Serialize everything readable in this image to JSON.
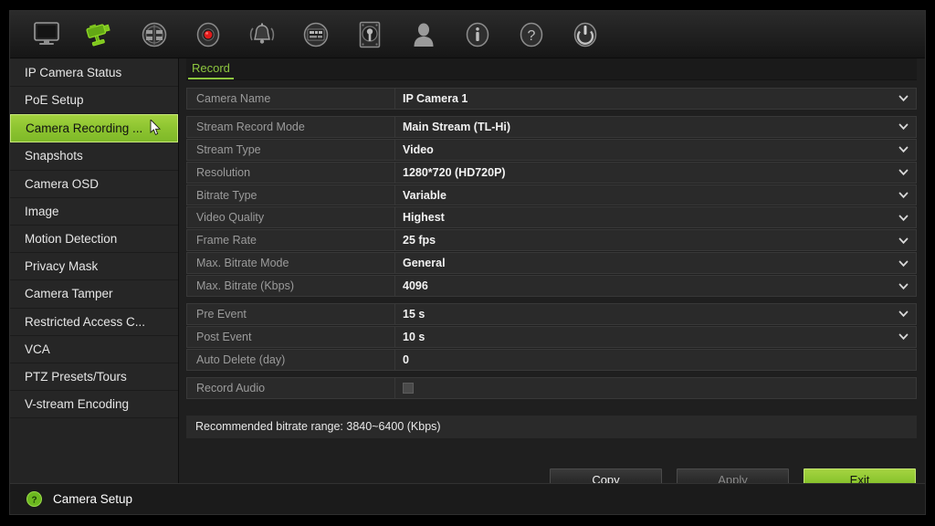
{
  "toolbar": {
    "items": [
      {
        "icon": "monitor-icon",
        "label": "Display",
        "active": false
      },
      {
        "icon": "camera-icon",
        "label": "Camera Setup",
        "active": true
      },
      {
        "icon": "network-icon",
        "label": "Network",
        "active": false
      },
      {
        "icon": "record-icon",
        "label": "Recording",
        "active": false
      },
      {
        "icon": "alarm-bell-icon",
        "label": "Alarm",
        "active": false
      },
      {
        "icon": "device-icon",
        "label": "Device",
        "active": false
      },
      {
        "icon": "hard-disk-icon",
        "label": "Storage",
        "active": false
      },
      {
        "icon": "user-icon",
        "label": "User",
        "active": false
      },
      {
        "icon": "info-icon",
        "label": "System Info",
        "active": false
      },
      {
        "icon": "help-icon",
        "label": "Help",
        "active": false
      },
      {
        "icon": "power-icon",
        "label": "Shutdown",
        "active": false
      }
    ]
  },
  "sidebar": {
    "items": [
      {
        "label": "IP Camera Status",
        "active": false
      },
      {
        "label": "PoE Setup",
        "active": false
      },
      {
        "label": "Camera Recording ...",
        "active": true
      },
      {
        "label": "Snapshots",
        "active": false
      },
      {
        "label": "Camera OSD",
        "active": false
      },
      {
        "label": "Image",
        "active": false
      },
      {
        "label": "Motion Detection",
        "active": false
      },
      {
        "label": "Privacy Mask",
        "active": false
      },
      {
        "label": "Camera Tamper",
        "active": false
      },
      {
        "label": "Restricted Access C...",
        "active": false
      },
      {
        "label": "VCA",
        "active": false
      },
      {
        "label": "PTZ Presets/Tours",
        "active": false
      },
      {
        "label": "V-stream Encoding",
        "active": false
      }
    ]
  },
  "tabs": [
    {
      "label": "Record",
      "active": true
    }
  ],
  "form": {
    "groups": [
      {
        "rows": [
          {
            "label": "Camera Name",
            "value": "IP Camera 1",
            "control": "dropdown"
          }
        ]
      },
      {
        "rows": [
          {
            "label": "Stream Record Mode",
            "value": "Main Stream (TL-Hi)",
            "control": "dropdown"
          },
          {
            "label": "Stream Type",
            "value": "Video",
            "control": "dropdown"
          },
          {
            "label": "Resolution",
            "value": "1280*720 (HD720P)",
            "control": "dropdown"
          },
          {
            "label": "Bitrate Type",
            "value": "Variable",
            "control": "dropdown"
          },
          {
            "label": "Video Quality",
            "value": "Highest",
            "control": "dropdown"
          },
          {
            "label": "Frame Rate",
            "value": "25 fps",
            "control": "dropdown"
          },
          {
            "label": "Max. Bitrate Mode",
            "value": "General",
            "control": "dropdown"
          },
          {
            "label": "Max. Bitrate (Kbps)",
            "value": "4096",
            "control": "dropdown"
          }
        ]
      },
      {
        "rows": [
          {
            "label": "Pre Event",
            "value": "15 s",
            "control": "dropdown"
          },
          {
            "label": "Post Event",
            "value": "10 s",
            "control": "dropdown"
          },
          {
            "label": "Auto Delete (day)",
            "value": "0",
            "control": "text"
          }
        ]
      },
      {
        "rows": [
          {
            "label": "Record Audio",
            "value": "",
            "control": "checkbox",
            "checked": false
          }
        ]
      }
    ]
  },
  "hint": {
    "text": "Recommended bitrate range: 3840~6400 (Kbps)"
  },
  "buttons": [
    {
      "label": "Copy",
      "style": "dark",
      "disabled": false
    },
    {
      "label": "Apply",
      "style": "dark",
      "disabled": true
    },
    {
      "label": "Exit",
      "style": "green",
      "disabled": false
    }
  ],
  "statusbar": {
    "icon": "help-circle-icon",
    "text": "Camera Setup"
  },
  "colors": {
    "accent_green": "#8dc63f",
    "highlight_green": "#8dc630",
    "panel_bg": "#1f1f1f",
    "row_bg": "#2a2a2a",
    "sidebar_bg": "#262626",
    "label_text": "#9b9b9b",
    "value_text": "#f2f2f2"
  }
}
